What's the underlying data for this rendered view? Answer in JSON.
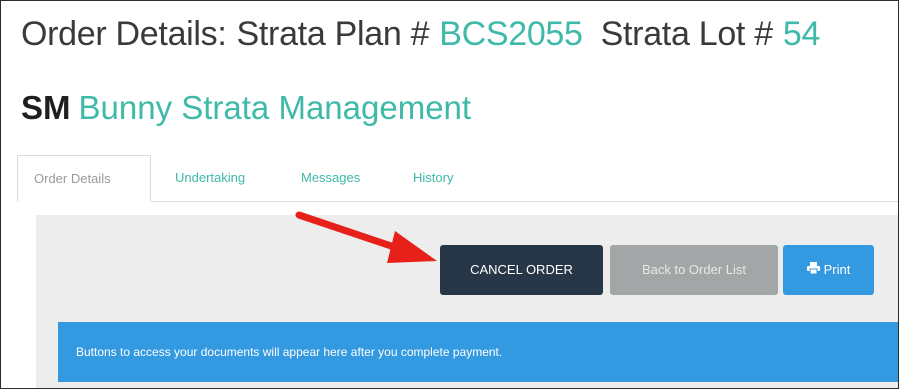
{
  "header": {
    "prefix": "Order Details:",
    "plan_label": "Strata Plan #",
    "plan_number": "BCS2055",
    "lot_label": "Strata Lot #",
    "lot_number": "54"
  },
  "management": {
    "code": "SM",
    "name": "Bunny Strata Management"
  },
  "tabs": [
    {
      "label": "Order Details",
      "active": true
    },
    {
      "label": "Undertaking",
      "active": false
    },
    {
      "label": "Messages",
      "active": false
    },
    {
      "label": "History",
      "active": false
    }
  ],
  "actions": {
    "cancel_label": "CANCEL ORDER",
    "back_label": "Back to Order List",
    "print_label": "Print",
    "print_icon": "printer-icon"
  },
  "notice": {
    "text": "Buttons to access your documents will appear here after you complete payment."
  },
  "annotation": {
    "arrow_icon": "red-arrow-icon",
    "arrow_color": "#e8201a"
  },
  "colors": {
    "accent_teal": "#3fb9a8",
    "cancel_bg": "#273748",
    "back_bg": "#a3a6a6",
    "print_bg": "#3399e0",
    "panel_bg": "#ededed"
  }
}
